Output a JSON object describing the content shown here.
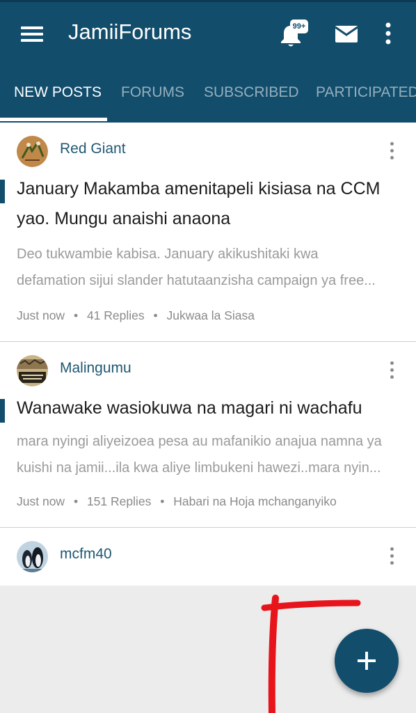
{
  "app": {
    "title": "JamiiForums",
    "notification_badge": "99+",
    "icons": [
      "menu-icon",
      "bell-icon",
      "mail-icon",
      "more-vert-icon"
    ],
    "colors": {
      "primary": "#124d6c",
      "background": "#ececec",
      "annotation": "#e8141b"
    }
  },
  "tabs": [
    {
      "label": "NEW POSTS",
      "active": true
    },
    {
      "label": "FORUMS",
      "active": false
    },
    {
      "label": "SUBSCRIBED",
      "active": false
    },
    {
      "label": "PARTICIPATED",
      "active": false
    }
  ],
  "posts": [
    {
      "author": "Red Giant",
      "title_lines": [
        "January Makamba amenitapeli kisiasa na CCM",
        "yao. Mungu anaishi anaona"
      ],
      "snippet_lines": [
        "Deo tukwambie kabisa. January akikushitaki kwa",
        "defamation sijui slander hatutaanzisha campaign ya free..."
      ],
      "time": "Just now",
      "replies": "41 Replies",
      "forum": "Jukwaa la Siasa",
      "separator": "•"
    },
    {
      "author": "Malingumu",
      "title_lines": [
        "Wanawake wasiokuwa na magari ni wachafu"
      ],
      "snippet_lines": [
        "mara nyingi aliyeizoea pesa au mafanikio anajua namna ya",
        "kuishi na jamii...ila kwa aliye limbukeni hawezi..mara nyin..."
      ],
      "time": "Just now",
      "replies": "151 Replies",
      "forum": "Habari na Hoja mchanganyiko",
      "separator": "•"
    },
    {
      "author": "mcfm40"
    }
  ],
  "fab": {
    "icon": "plus-icon"
  }
}
